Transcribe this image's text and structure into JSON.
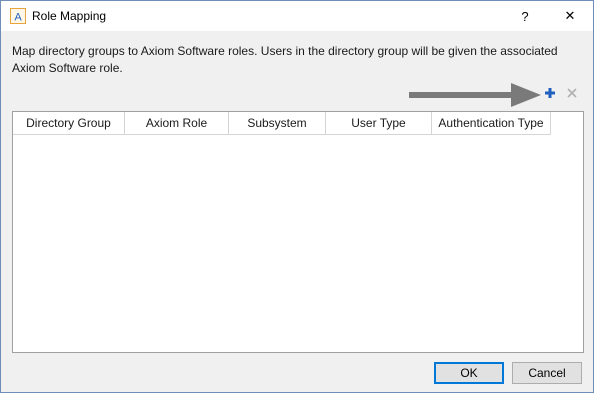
{
  "window": {
    "title": "Role Mapping",
    "app_icon_letter": "A",
    "help_glyph": "?",
    "close_glyph": "✕"
  },
  "description": "Map directory groups to Axiom Software roles. Users in the directory group will be given the associated Axiom Software role.",
  "toolbar": {
    "add_icon": "plus-icon",
    "remove_icon": "x-icon",
    "annotation": "arrow pointing to add button"
  },
  "grid": {
    "columns": [
      "Directory Group",
      "Axiom Role",
      "Subsystem",
      "User Type",
      "Authentication Type"
    ],
    "rows": []
  },
  "buttons": {
    "ok_label": "OK",
    "cancel_label": "Cancel"
  },
  "colors": {
    "accent": "#0078d7",
    "icon_orange": "#e8a33d",
    "add_blue": "#1f5fbf",
    "arrow_gray": "#7a7a7a"
  }
}
